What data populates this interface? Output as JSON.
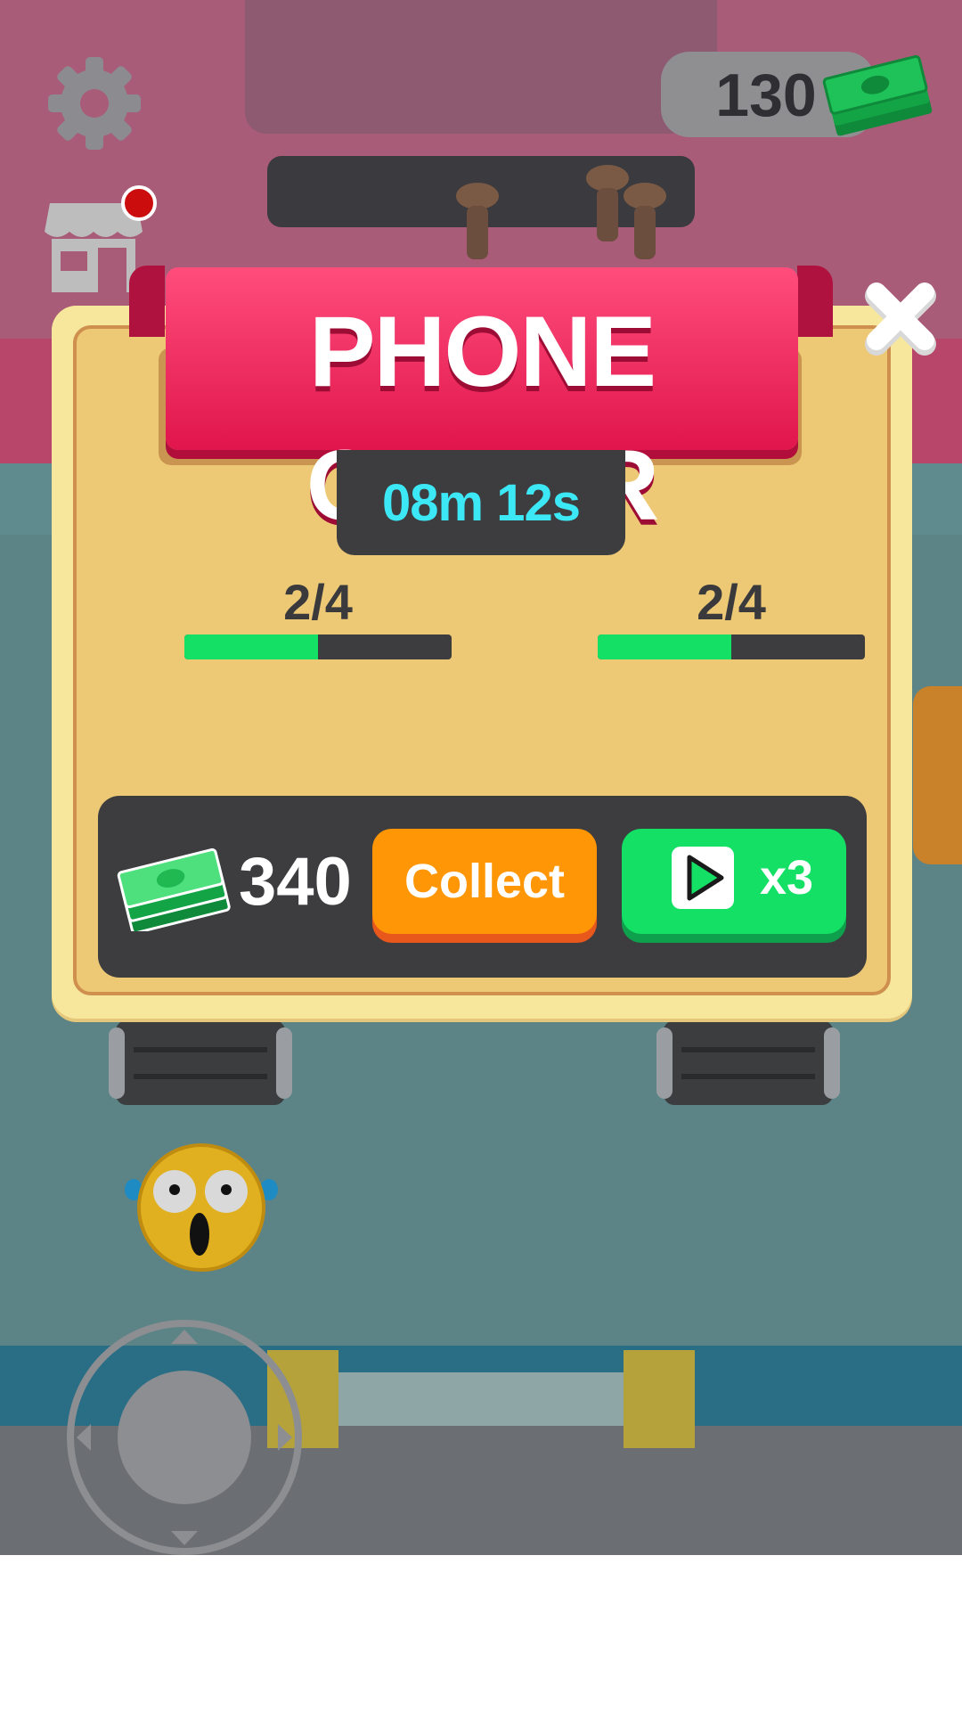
{
  "hud": {
    "cash": "130",
    "settings_icon": "gear-icon",
    "shop_icon": "shop-icon",
    "shop_notification": true
  },
  "dialog": {
    "title": "PHONE ORDER",
    "timer": "08m 12s",
    "orders": [
      {
        "label": "2/4",
        "progress": 0.5
      },
      {
        "label": "2/4",
        "progress": 0.5
      }
    ],
    "reward": {
      "amount": "340",
      "icon": "cash-stack-icon"
    },
    "collect_label": "Collect",
    "ad_label": "x3",
    "ad_icon": "play-video-icon",
    "close_icon": "close-icon"
  },
  "colors": {
    "banner": "#e0154c",
    "timer_text": "#3ce8f5",
    "collect_button": "#ff9605",
    "ad_button": "#14e066",
    "progress_fill": "#14e066"
  },
  "controls": {
    "joystick_icon": "joystick-icon"
  }
}
